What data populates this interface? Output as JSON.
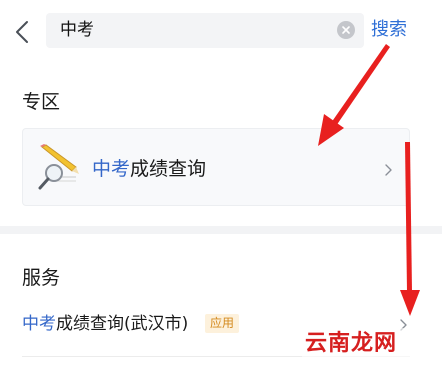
{
  "search": {
    "query": "中考",
    "submit_label": "搜索"
  },
  "zone": {
    "section_title": "专区",
    "card": {
      "highlight": "中考",
      "rest": "成绩查询"
    }
  },
  "services": {
    "section_title": "服务",
    "item": {
      "highlight": "中考",
      "rest": "成绩查询(武汉市)",
      "tag": "应用"
    }
  },
  "watermark": {
    "text": "云南龙网"
  },
  "colors": {
    "accent": "#2f6fd6",
    "highlight": "#3467c9",
    "tag_text": "#d48a1e",
    "tag_bg": "#fdf1dc",
    "annotation_arrow": "#e8201f"
  },
  "icons": {
    "back": "chevron-left-icon",
    "clear": "clear-icon",
    "card": "magnifier-pencil-icon",
    "chevron": "chevron-right-icon"
  }
}
